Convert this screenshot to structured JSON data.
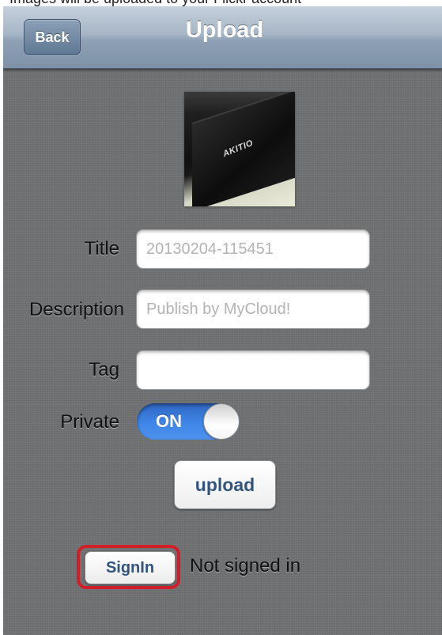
{
  "page_top_caption": "Images will be uploaded to your Flickr account",
  "navbar": {
    "back_label": "Back",
    "title": "Upload"
  },
  "photo": {
    "logo_text": "AKITIO"
  },
  "form": {
    "title_label": "Title",
    "title_placeholder": "20130204-115451",
    "description_label": "Description",
    "description_placeholder": "Publish by MyCloud!",
    "tag_label": "Tag",
    "tag_value": "",
    "private_label": "Private",
    "private_toggle": "ON"
  },
  "upload_button": "upload",
  "signin": {
    "button_label": "SignIn",
    "status": "Not signed in"
  },
  "colors": {
    "highlight": "#d11f2a",
    "toggle_on": "#3f86e8",
    "button_text": "#32547e"
  }
}
